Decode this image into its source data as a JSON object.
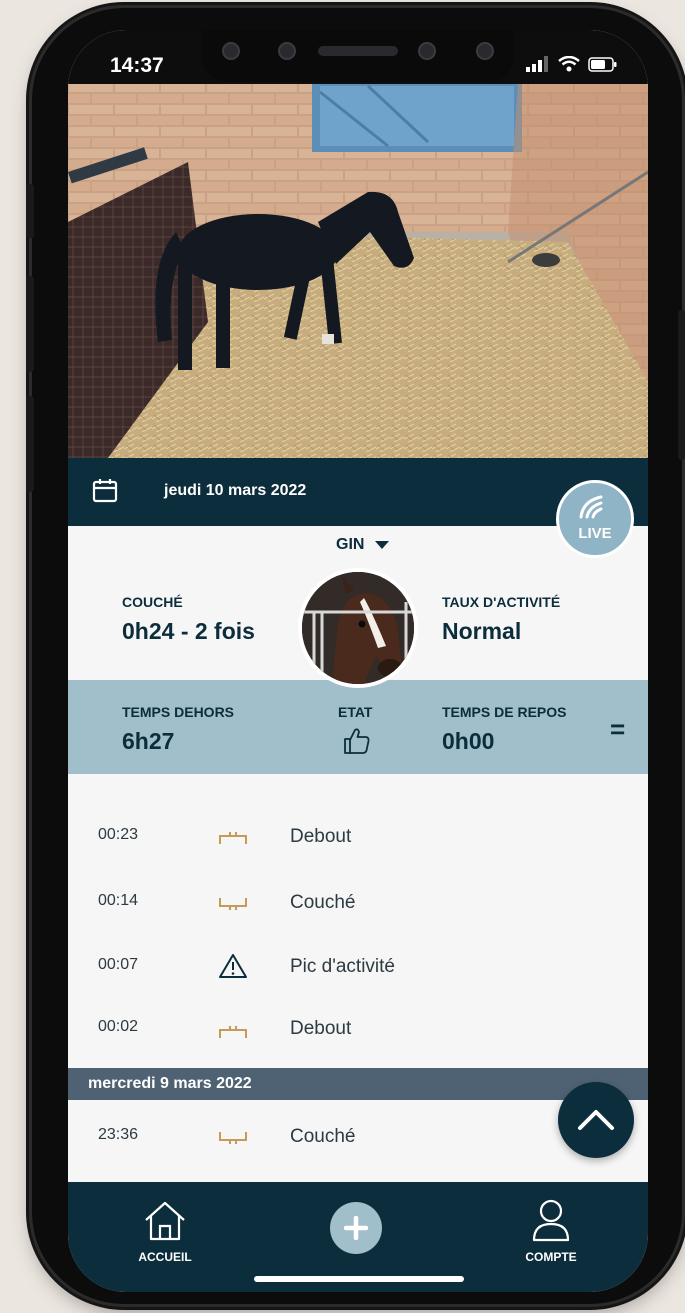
{
  "status_bar": {
    "time": "14:37"
  },
  "header": {
    "date": "jeudi 10 mars 2022",
    "live_label": "LIVE"
  },
  "horse": {
    "name": "GIN"
  },
  "stats": {
    "couche_label": "COUCHÉ",
    "couche_value": "0h24 - 2 fois",
    "activity_label": "TAUX D'ACTIVITÉ",
    "activity_value": "Normal",
    "outside_label": "TEMPS DEHORS",
    "outside_value": "6h27",
    "state_label": "ETAT",
    "rest_label": "TEMPS DE REPOS",
    "rest_value": "0h00",
    "trend_symbol": "="
  },
  "timeline": [
    {
      "time": "00:23",
      "icon": "standing-icon",
      "label": "Debout"
    },
    {
      "time": "00:14",
      "icon": "lying-icon",
      "label": "Couché"
    },
    {
      "time": "00:07",
      "icon": "warning-icon",
      "label": "Pic d'activité"
    },
    {
      "time": "00:02",
      "icon": "standing-icon",
      "label": "Debout"
    }
  ],
  "previous_day": {
    "date": "mercredi 9 mars 2022",
    "events": [
      {
        "time": "23:36",
        "icon": "lying-icon",
        "label": "Couché"
      }
    ]
  },
  "nav": {
    "home_label": "ACCUEIL",
    "account_label": "COMPTE"
  },
  "colors": {
    "primary": "#0c2d3b",
    "accent": "#a1becb",
    "day_header": "#4f6274",
    "event_icon": "#c79a55"
  }
}
